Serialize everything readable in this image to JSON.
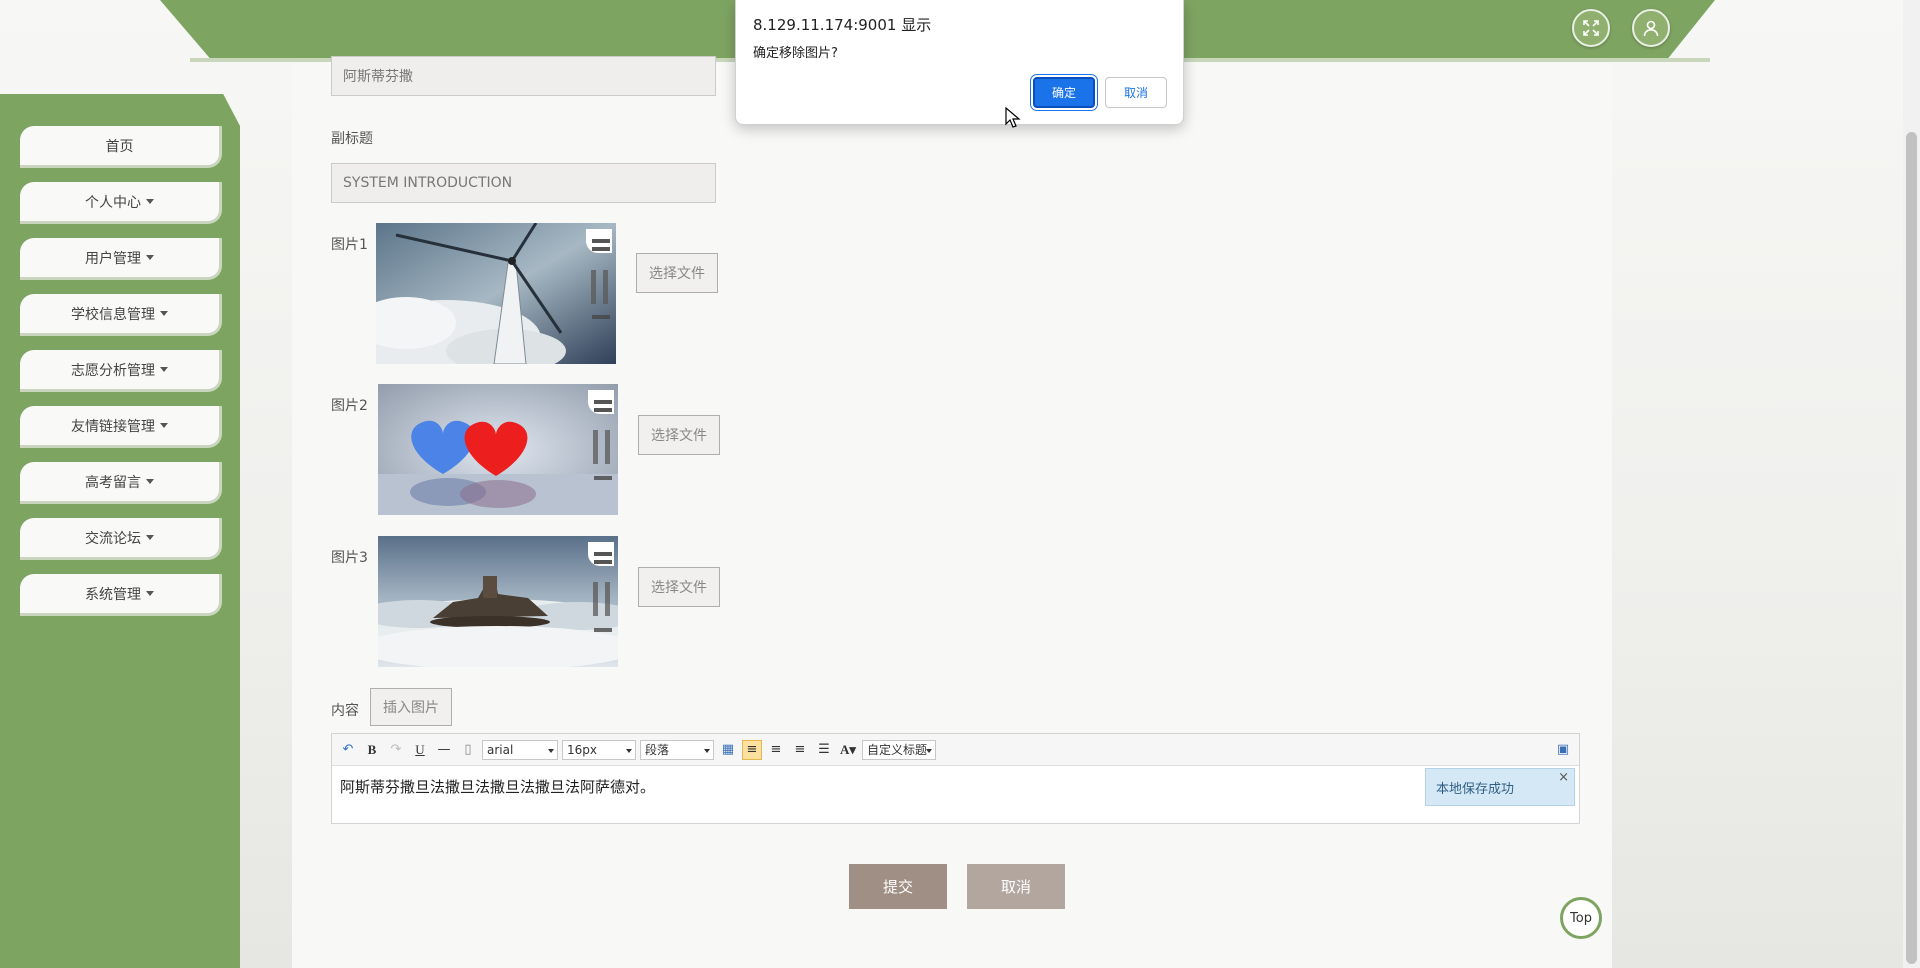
{
  "header": {
    "fullscreen_icon": "fullscreen-icon",
    "user_icon": "user-icon"
  },
  "sidebar": {
    "items": [
      {
        "label": "首页",
        "dropdown": false
      },
      {
        "label": "个人中心",
        "dropdown": true
      },
      {
        "label": "用户管理",
        "dropdown": true
      },
      {
        "label": "学校信息管理",
        "dropdown": true
      },
      {
        "label": "志愿分析管理",
        "dropdown": true
      },
      {
        "label": "友情链接管理",
        "dropdown": true
      },
      {
        "label": "高考留言",
        "dropdown": true
      },
      {
        "label": "交流论坛",
        "dropdown": true
      },
      {
        "label": "系统管理",
        "dropdown": true
      }
    ]
  },
  "form": {
    "title_value": "阿斯蒂芬撒",
    "subtitle_label": "副标题",
    "subtitle_value": "SYSTEM INTRODUCTION",
    "images": [
      {
        "label": "图片1",
        "button": "选择文件"
      },
      {
        "label": "图片2",
        "button": "选择文件"
      },
      {
        "label": "图片3",
        "button": "选择文件"
      }
    ],
    "content_label": "内容",
    "insert_image_button": "插入图片"
  },
  "editor": {
    "font_family": "arial",
    "font_size": "16px",
    "paragraph": "段落",
    "custom_title": "自定义标题",
    "content": "阿斯蒂芬撒旦法撒旦法撒旦法撒旦法阿萨德对。",
    "toast": "本地保存成功",
    "toast_close": "×"
  },
  "actions": {
    "submit": "提交",
    "cancel": "取消",
    "submit_color": "#a08f84",
    "cancel_color": "#b3a69e"
  },
  "top_button": "Top",
  "dialog": {
    "title": "8.129.11.174:9001 显示",
    "message": "确定移除图片?",
    "ok": "确定",
    "cancel": "取消"
  },
  "colors": {
    "accent_green": "#7ea462",
    "dialog_blue": "#1a73e8"
  }
}
